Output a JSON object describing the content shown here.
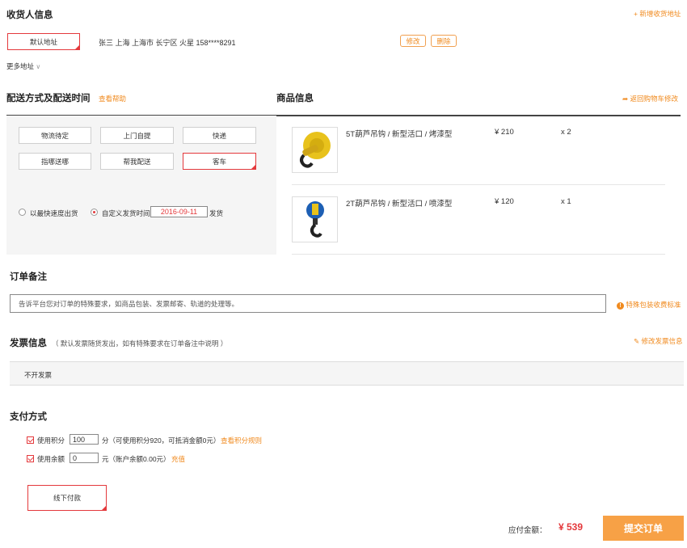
{
  "receiver": {
    "title": "收货人信息",
    "new_address": "新增收货地址",
    "default_label": "默认地址",
    "address": "张三 上海 上海市 长宁区 火星 158****8291",
    "edit_label": "修改",
    "delete_label": "删除",
    "more_label": "更多地址"
  },
  "delivery": {
    "title": "配送方式及配送时间",
    "help_label": "查看帮助",
    "options": [
      "物流待定",
      "上门自提",
      "快递",
      "指哪送哪",
      "帮我配送",
      "客车"
    ],
    "selected": "客车",
    "radio_fast": "以最快速度出货",
    "radio_custom": "自定义发货时间",
    "date_value": "2016-09-11",
    "ship_suffix": "发货"
  },
  "goods": {
    "title": "商品信息",
    "back_label": "返回购物车修改",
    "items": [
      {
        "name": "5T葫芦吊钩 / 新型活口 / 烤漆型",
        "price": "¥ 210",
        "qty": "x 2"
      },
      {
        "name": "2T葫芦吊钩 / 新型活口 / 喷漆型",
        "price": "¥ 120",
        "qty": "x 1"
      }
    ]
  },
  "remark": {
    "title": "订单备注",
    "placeholder": "告诉平台您对订单的特殊要求，如商品包装、发票邮寄、轨道的处理等。",
    "special_label": "特殊包装收费标准"
  },
  "invoice": {
    "title": "发票信息",
    "note": "（ 默认发票随货发出，如有特殊要求在订单备注中说明 ）",
    "edit_label": "修改发票信息",
    "value": "不开发票"
  },
  "payment": {
    "title": "支付方式",
    "points_label": "使用积分",
    "points_value": "100",
    "points_desc": "分（可使用积分920，可抵消金额0元）",
    "points_rule": "查看积分规则",
    "balance_label": "使用余额",
    "balance_value": "0",
    "balance_desc": "元（账户余额0.00元）",
    "recharge": "充值",
    "offline_label": "线下付款"
  },
  "footer": {
    "amount_label": "应付金额：",
    "amount_value": "¥ 539",
    "submit_label": "提交订单"
  },
  "colors": {
    "accent": "#f08a1e",
    "selected_border": "#e4393c",
    "submit_bg": "#f7a146"
  }
}
